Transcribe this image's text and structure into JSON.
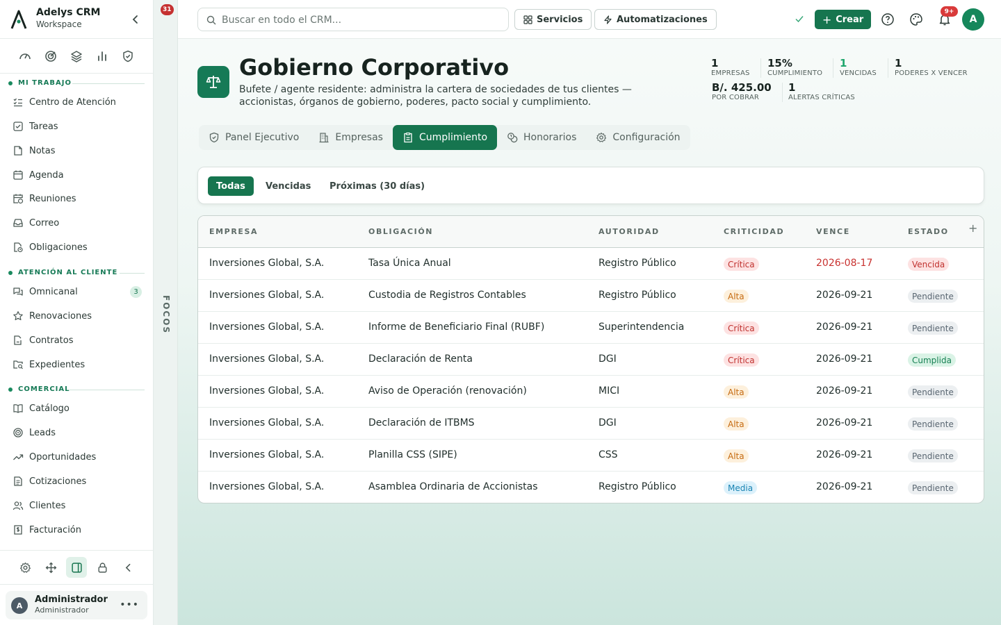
{
  "sidebar": {
    "app_name": "Adelys CRM",
    "app_sub": "Workspace",
    "quick_icons": [
      "gauge-icon",
      "target-icon",
      "layers-icon",
      "bar-chart-icon",
      "shield-check-icon"
    ],
    "sections": [
      {
        "title": "MI TRABAJO",
        "items": [
          {
            "label": "Centro de Atención",
            "icon": "list-check-icon"
          },
          {
            "label": "Tareas",
            "icon": "task-icon"
          },
          {
            "label": "Notas",
            "icon": "note-icon"
          },
          {
            "label": "Agenda",
            "icon": "calendar-icon"
          },
          {
            "label": "Reuniones",
            "icon": "calendar-clock-icon"
          },
          {
            "label": "Correo",
            "icon": "inbox-icon"
          },
          {
            "label": "Obligaciones",
            "icon": "file-clock-icon"
          }
        ]
      },
      {
        "title": "ATENCIÓN AL CLIENTE",
        "items": [
          {
            "label": "Omnicanal",
            "icon": "chat-icon",
            "badge": "3"
          },
          {
            "label": "Renovaciones",
            "icon": "star-icon"
          },
          {
            "label": "Contratos",
            "icon": "file-signature-icon"
          },
          {
            "label": "Expedientes",
            "icon": "folder-search-icon"
          }
        ]
      },
      {
        "title": "COMERCIAL",
        "items": [
          {
            "label": "Catálogo",
            "icon": "book-icon"
          },
          {
            "label": "Leads",
            "icon": "target-icon"
          },
          {
            "label": "Oportunidades",
            "icon": "trend-up-icon"
          },
          {
            "label": "Cotizaciones",
            "icon": "document-icon"
          },
          {
            "label": "Clientes",
            "icon": "users-icon"
          },
          {
            "label": "Facturación",
            "icon": "invoice-icon"
          }
        ]
      }
    ],
    "footer_tools": [
      "settings-icon",
      "move-icon",
      "panel-icon",
      "lock-icon",
      "chevron-left-icon"
    ],
    "user": {
      "initial": "A",
      "name": "Administrador",
      "role": "Administrador"
    }
  },
  "focos": {
    "label": "FOCOS",
    "badge": "31"
  },
  "topbar": {
    "search_placeholder": "Buscar en todo el CRM...",
    "services_label": "Servicios",
    "automations_label": "Automatizaciones",
    "create_label": "Crear",
    "notif_badge": "9+",
    "avatar_initial": "A"
  },
  "header": {
    "title": "Gobierno Corporativo",
    "subtitle": "Bufete / agente residente: administra la cartera de sociedades de tus clientes — accionistas, órganos de gobierno, poderes, pacto social y cumplimiento.",
    "stats": [
      {
        "value": "1",
        "label": "EMPRESAS"
      },
      {
        "value": "15%",
        "label": "CUMPLIMIENTO"
      },
      {
        "value": "1",
        "label": "VENCIDAS"
      },
      {
        "value": "1",
        "label": "PODERES X VENCER"
      },
      {
        "value": "B/. 425.00",
        "label": "POR COBRAR"
      },
      {
        "value": "1",
        "label": "ALERTAS CRÍTICAS"
      }
    ]
  },
  "tabs": [
    {
      "label": "Panel Ejecutivo",
      "icon": "shield-icon"
    },
    {
      "label": "Empresas",
      "icon": "building-icon"
    },
    {
      "label": "Cumplimiento",
      "icon": "clipboard-icon",
      "active": true
    },
    {
      "label": "Honorarios",
      "icon": "coins-icon"
    },
    {
      "label": "Configuración",
      "icon": "gear-icon"
    }
  ],
  "filters": [
    "Todas",
    "Vencidas",
    "Próximas (30 días)"
  ],
  "table": {
    "columns": [
      "EMPRESA",
      "OBLIGACIÓN",
      "AUTORIDAD",
      "CRITICIDAD",
      "VENCE",
      "ESTADO"
    ],
    "rows": [
      {
        "empresa": "Inversiones Global, S.A.",
        "obligacion": "Tasa Única Anual",
        "autoridad": "Registro Público",
        "criticidad": "Crítica",
        "vence": "2026-08-17",
        "estado": "Vencida"
      },
      {
        "empresa": "Inversiones Global, S.A.",
        "obligacion": "Custodia de Registros Contables",
        "autoridad": "Registro Público",
        "criticidad": "Alta",
        "vence": "2026-09-21",
        "estado": "Pendiente"
      },
      {
        "empresa": "Inversiones Global, S.A.",
        "obligacion": "Informe de Beneficiario Final (RUBF)",
        "autoridad": "Superintendencia",
        "criticidad": "Crítica",
        "vence": "2026-09-21",
        "estado": "Pendiente"
      },
      {
        "empresa": "Inversiones Global, S.A.",
        "obligacion": "Declaración de Renta",
        "autoridad": "DGI",
        "criticidad": "Crítica",
        "vence": "2026-09-21",
        "estado": "Cumplida"
      },
      {
        "empresa": "Inversiones Global, S.A.",
        "obligacion": "Aviso de Operación (renovación)",
        "autoridad": "MICI",
        "criticidad": "Alta",
        "vence": "2026-09-21",
        "estado": "Pendiente"
      },
      {
        "empresa": "Inversiones Global, S.A.",
        "obligacion": "Declaración de ITBMS",
        "autoridad": "DGI",
        "criticidad": "Alta",
        "vence": "2026-09-21",
        "estado": "Pendiente"
      },
      {
        "empresa": "Inversiones Global, S.A.",
        "obligacion": "Planilla CSS (SIPE)",
        "autoridad": "CSS",
        "criticidad": "Alta",
        "vence": "2026-09-21",
        "estado": "Pendiente"
      },
      {
        "empresa": "Inversiones Global, S.A.",
        "obligacion": "Asamblea Ordinaria de Accionistas",
        "autoridad": "Registro Público",
        "criticidad": "Media",
        "vence": "2026-09-21",
        "estado": "Pendiente"
      }
    ]
  },
  "colors": {
    "accent": "#16754f",
    "danger": "#c8312f",
    "background": "#eef6f3"
  }
}
